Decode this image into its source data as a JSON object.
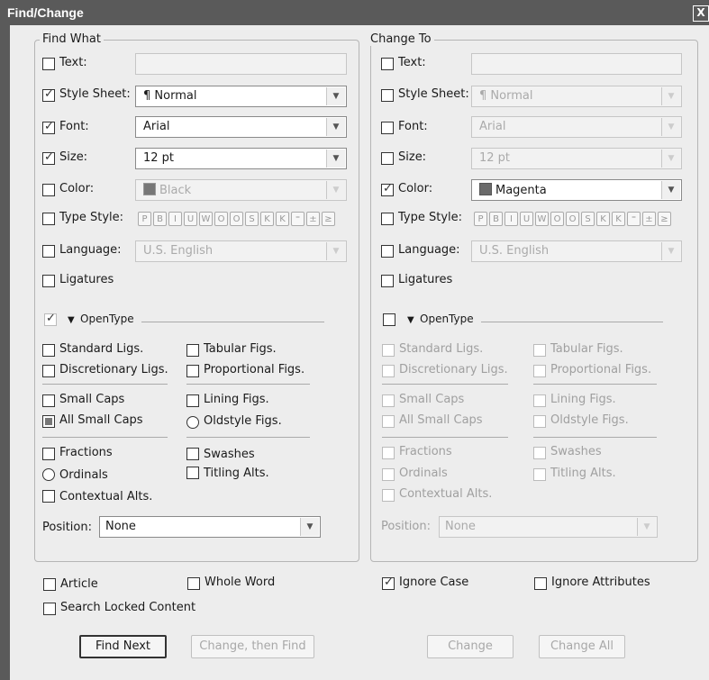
{
  "window": {
    "title": "Find/Change",
    "close": "X"
  },
  "find": {
    "group_title": "Find What",
    "text": {
      "label": "Text:",
      "value": ""
    },
    "style_sheet": {
      "label": "Style Sheet:",
      "value": "Normal",
      "glyph": "¶"
    },
    "font": {
      "label": "Font:",
      "value": "Arial"
    },
    "size": {
      "label": "Size:",
      "value": "12 pt"
    },
    "color": {
      "label": "Color:",
      "value": "Black",
      "swatch": "#777777"
    },
    "type_style": {
      "label": "Type Style:"
    },
    "language": {
      "label": "Language:",
      "value": "U.S. English"
    },
    "ligatures": {
      "label": "Ligatures"
    },
    "opentype": {
      "label": "OpenType"
    },
    "ot": {
      "standard_ligs": "Standard Ligs.",
      "tabular_figs": "Tabular Figs.",
      "discretionary_ligs": "Discretionary Ligs.",
      "proportional_figs": "Proportional Figs.",
      "small_caps": "Small Caps",
      "lining_figs": "Lining Figs.",
      "all_small_caps": "All Small Caps",
      "oldstyle_figs": "Oldstyle Figs.",
      "fractions": "Fractions",
      "swashes": "Swashes",
      "ordinals": "Ordinals",
      "titling_alts": "Titling Alts.",
      "contextual_alts": "Contextual Alts."
    },
    "position": {
      "label": "Position:",
      "value": "None"
    }
  },
  "change": {
    "group_title": "Change To",
    "text": {
      "label": "Text:",
      "value": ""
    },
    "style_sheet": {
      "label": "Style Sheet:",
      "value": "Normal",
      "glyph": "¶"
    },
    "font": {
      "label": "Font:",
      "value": "Arial"
    },
    "size": {
      "label": "Size:",
      "value": "12 pt"
    },
    "color": {
      "label": "Color:",
      "value": "Magenta",
      "swatch": "#6a6a6a"
    },
    "type_style": {
      "label": "Type Style:"
    },
    "language": {
      "label": "Language:",
      "value": "U.S. English"
    },
    "ligatures": {
      "label": "Ligatures"
    },
    "opentype": {
      "label": "OpenType"
    },
    "ot": {
      "standard_ligs": "Standard Ligs.",
      "tabular_figs": "Tabular Figs.",
      "discretionary_ligs": "Discretionary Ligs.",
      "proportional_figs": "Proportional Figs.",
      "small_caps": "Small Caps",
      "lining_figs": "Lining Figs.",
      "all_small_caps": "All Small Caps",
      "oldstyle_figs": "Oldstyle Figs.",
      "fractions": "Fractions",
      "swashes": "Swashes",
      "ordinals": "Ordinals",
      "titling_alts": "Titling Alts.",
      "contextual_alts": "Contextual Alts."
    },
    "position": {
      "label": "Position:",
      "value": "None"
    }
  },
  "type_style_buttons": [
    "P",
    "B",
    "I",
    "U",
    "W",
    "O",
    "O",
    "S",
    "K",
    "K",
    "⁼",
    "±",
    "≥"
  ],
  "options": {
    "article": "Article",
    "whole_word": "Whole Word",
    "search_locked": "Search Locked Content",
    "ignore_case": "Ignore Case",
    "ignore_attributes": "Ignore Attributes"
  },
  "buttons": {
    "find_next": "Find Next",
    "change_then_find": "Change, then Find",
    "change": "Change",
    "change_all": "Change All"
  }
}
